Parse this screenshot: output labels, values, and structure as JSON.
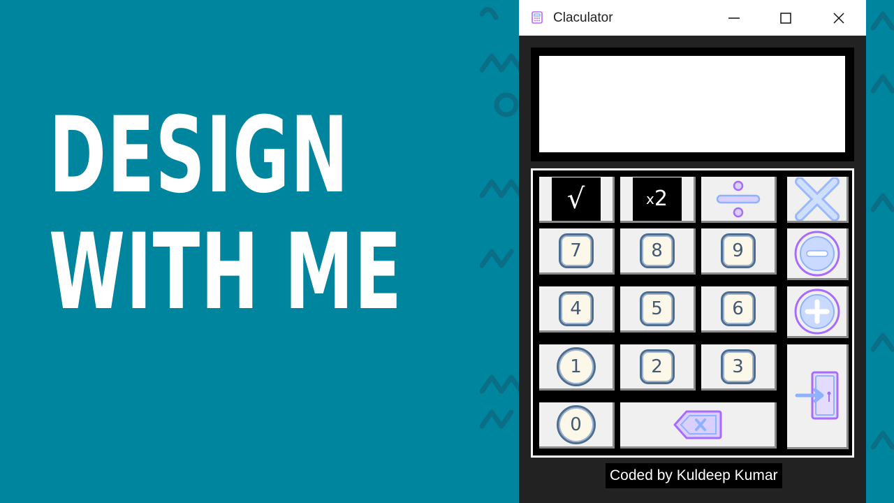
{
  "headline": {
    "line1": "DESIGN",
    "line2": "WITH ME"
  },
  "window": {
    "title": "Claculator",
    "minimize": "—",
    "maximize": "☐",
    "close": "✕"
  },
  "display": {
    "value": ""
  },
  "keys": {
    "sqrt": "√",
    "square": {
      "x": "x",
      "two": "2"
    },
    "k7": "7",
    "k8": "8",
    "k9": "9",
    "k4": "4",
    "k5": "5",
    "k6": "6",
    "k1": "1",
    "k2": "2",
    "k3": "3",
    "k0": "0"
  },
  "icons": {
    "divide": "divide-icon",
    "multiply": "multiply-icon",
    "minus": "minus-circle-icon",
    "plus": "plus-circle-icon",
    "backspace": "backspace-icon",
    "exit": "exit-door-icon"
  },
  "credit": "Coded by Kuldeep Kumar",
  "colors": {
    "background": "#00859f",
    "window": "#222222",
    "accent": "#b866ff",
    "blue": "#6fa3ff"
  }
}
